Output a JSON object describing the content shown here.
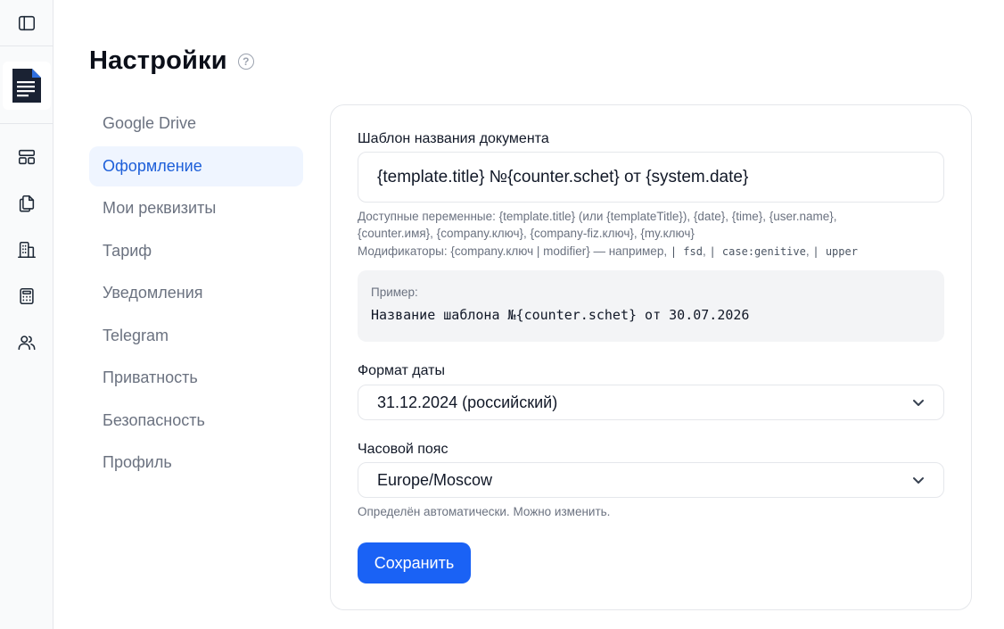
{
  "page": {
    "title": "Настройки"
  },
  "side_menu": {
    "items": [
      {
        "label": "Google Drive",
        "active": false
      },
      {
        "label": "Оформление",
        "active": true
      },
      {
        "label": "Мои реквизиты",
        "active": false
      },
      {
        "label": "Тариф",
        "active": false
      },
      {
        "label": "Уведомления",
        "active": false
      },
      {
        "label": "Telegram",
        "active": false
      },
      {
        "label": "Приватность",
        "active": false
      },
      {
        "label": "Безопасность",
        "active": false
      },
      {
        "label": "Профиль",
        "active": false
      }
    ]
  },
  "rail": {
    "icons": [
      "sidebar-toggle-icon",
      "document-logo-icon",
      "layout-icon",
      "copy-icon",
      "building-icon",
      "calculator-icon",
      "users-icon"
    ]
  },
  "form": {
    "template": {
      "label": "Шаблон названия документа",
      "value": "{template.title} №{counter.schet} от {system.date}",
      "hint_vars_line1": "Доступные переменные: {template.title} (или {templateTitle}), {date}, {time}, {user.name},",
      "hint_vars_line2": "{counter.имя}, {company.ключ}, {company-fiz.ключ}, {my.ключ}",
      "hint_mods_prefix": "Модификаторы: {company.ключ | modifier} — например,",
      "hint_mods_codes": [
        "| fsd",
        "| case:genitive",
        "| upper"
      ],
      "example_caption": "Пример:",
      "example_value": "Название шаблона №{counter.schet} от 30.07.2026"
    },
    "date_format": {
      "label": "Формат даты",
      "value": "31.12.2024 (российский)"
    },
    "timezone": {
      "label": "Часовой пояс",
      "value": "Europe/Moscow",
      "hint": "Определён автоматически. Можно изменить."
    },
    "save_label": "Сохранить"
  },
  "colors": {
    "accent": "#1a62f5",
    "active_menu_bg": "#eff5ff",
    "active_menu_text": "#1d5fd9"
  }
}
